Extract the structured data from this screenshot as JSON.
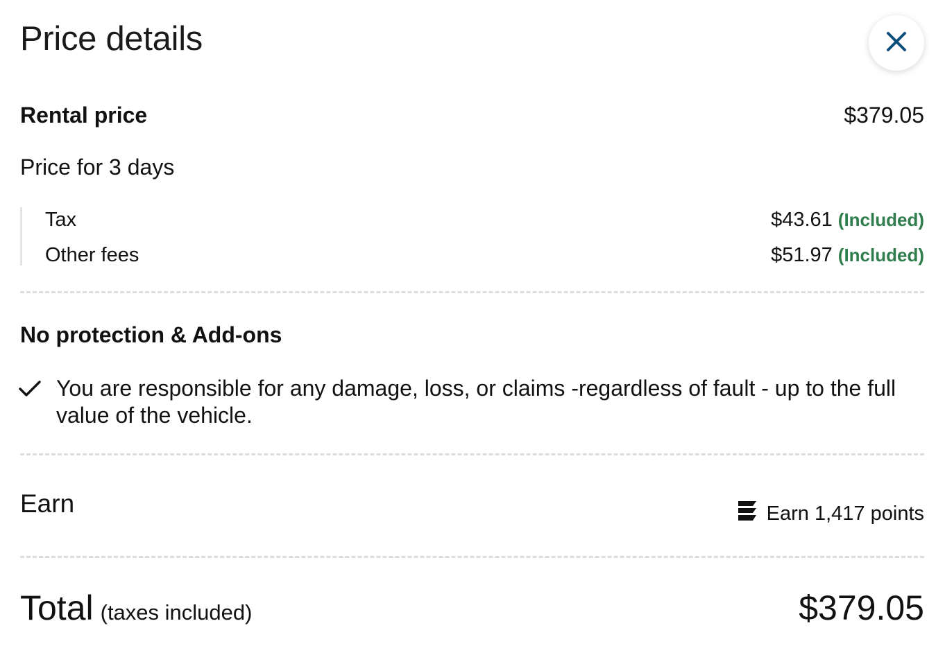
{
  "title": "Price details",
  "close_icon": "close-icon",
  "rental": {
    "label": "Rental price",
    "amount": "$379.05",
    "subtitle": "Price for 3 days"
  },
  "fees": [
    {
      "label": "Tax",
      "amount": "$43.61",
      "status": "(Included)"
    },
    {
      "label": "Other fees",
      "amount": "$51.97",
      "status": "(Included)"
    }
  ],
  "protection": {
    "heading": "No protection & Add-ons",
    "icon": "checkmark-icon",
    "item_text": "You are responsible for any damage, loss, or claims -regardless of fault - up to the full value of the vehicle."
  },
  "earn": {
    "label": "Earn",
    "icon": "points-logo-icon",
    "points_text": "Earn 1,417 points"
  },
  "total": {
    "label": "Total",
    "sublabel": "(taxes included)",
    "amount": "$379.05"
  },
  "colors": {
    "accent": "#0d4f7c",
    "included_green": "#2f7d4c",
    "divider": "#dcdcdf"
  }
}
